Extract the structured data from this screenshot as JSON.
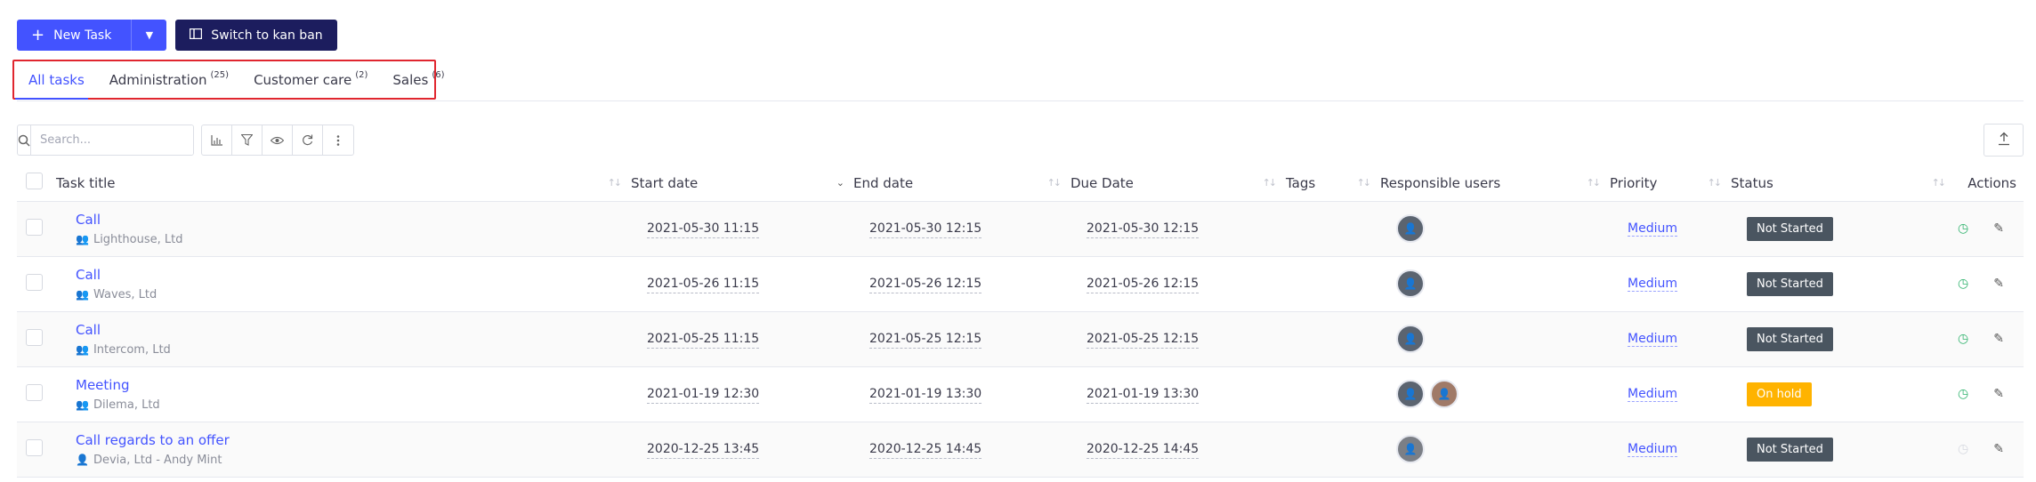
{
  "toolbar": {
    "new_task_label": "New Task",
    "kanban_label": "Switch to kan ban"
  },
  "tabs": [
    {
      "label": "All tasks",
      "count": ""
    },
    {
      "label": "Administration",
      "count": "(25)"
    },
    {
      "label": "Customer care",
      "count": "(2)"
    },
    {
      "label": "Sales",
      "count": "(6)"
    }
  ],
  "search": {
    "placeholder": "Search..."
  },
  "columns": {
    "title": "Task title",
    "start": "Start date",
    "end": "End date",
    "due": "Due Date",
    "tags": "Tags",
    "users": "Responsible users",
    "priority": "Priority",
    "status": "Status",
    "actions": "Actions"
  },
  "rows": [
    {
      "title": "Call",
      "company": "Lighthouse, Ltd",
      "start": "2021-05-30 11:15",
      "end": "2021-05-30 12:15",
      "due": "2021-05-30 12:15",
      "priority": "Medium",
      "status": "Not Started"
    },
    {
      "title": "Call",
      "company": "Waves, Ltd",
      "start": "2021-05-26 11:15",
      "end": "2021-05-26 12:15",
      "due": "2021-05-26 12:15",
      "priority": "Medium",
      "status": "Not Started"
    },
    {
      "title": "Call",
      "company": "Intercom, Ltd",
      "start": "2021-05-25 11:15",
      "end": "2021-05-25 12:15",
      "due": "2021-05-25 12:15",
      "priority": "Medium",
      "status": "Not Started"
    },
    {
      "title": "Meeting",
      "company": "Dilema, Ltd",
      "start": "2021-01-19 12:30",
      "end": "2021-01-19 13:30",
      "due": "2021-01-19 13:30",
      "priority": "Medium",
      "status": "On hold"
    },
    {
      "title": "Call regards to an offer",
      "company": "Devia, Ltd - Andy Mint",
      "start": "2020-12-25 13:45",
      "end": "2020-12-25 14:45",
      "due": "2020-12-25 14:45",
      "priority": "Medium",
      "status": "Not Started"
    }
  ],
  "colors": {
    "accent": "#4353ff",
    "kanban": "#1c1d5e",
    "not_started": "#4a5560",
    "on_hold": "#ffb300",
    "highlight": "#e0262f"
  }
}
